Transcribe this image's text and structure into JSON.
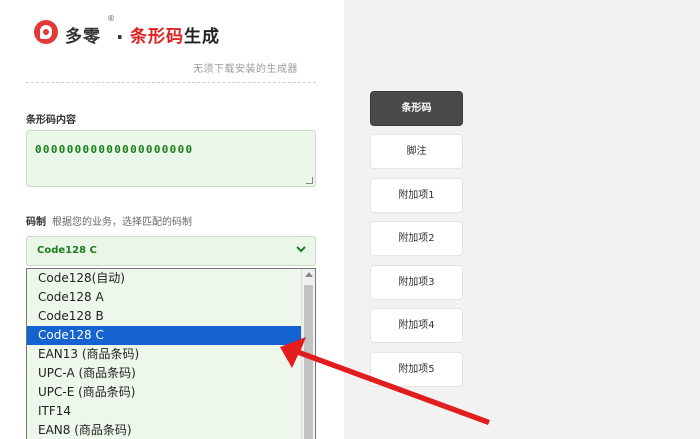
{
  "header": {
    "brand": "多零",
    "reg_mark": "®",
    "separator": ".",
    "title_red": "条形码",
    "title_dark": "生成",
    "subtitle": "无须下载安装的生成器"
  },
  "content_section": {
    "label": "条形码内容",
    "value": "00000000000000000000"
  },
  "code_section": {
    "label": "码制",
    "hint": "根据您的业务，选择匹配的码制",
    "selected": "Code128 C",
    "options": [
      "Code128(自动)",
      "Code128 A",
      "Code128 B",
      "Code128 C",
      "EAN13 (商品条码)",
      "UPC-A (商品条码)",
      "UPC-E (商品条码)",
      "ITF14",
      "EAN8 (商品条码)"
    ]
  },
  "tabs": [
    "条形码",
    "脚注",
    "附加项1",
    "附加项2",
    "附加项3",
    "附加项4",
    "附加项5"
  ],
  "colors": {
    "accent_red": "#e02020",
    "field_green": "#eaf6e8",
    "text_green": "#1a7f1a",
    "selection_blue": "#1463d1",
    "active_tab": "#4a4a4a"
  }
}
